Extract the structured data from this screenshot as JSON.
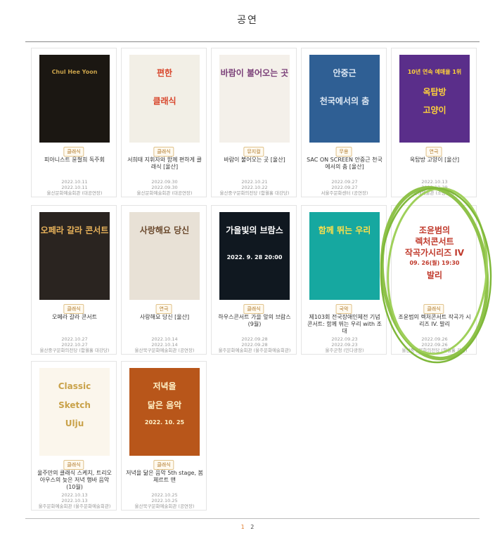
{
  "page": {
    "title": "공연"
  },
  "cards": [
    {
      "category": "클래식",
      "name": "피아니스트 윤철희 독주회",
      "d1": "2022.10.11",
      "d2": "2022.10.11",
      "venue": "울산문화예술회관 (대공연장)",
      "poster": {
        "bg": "#1b1712",
        "accent": "#c9a24a",
        "lines": [
          "Chul Hee Yoon"
        ]
      }
    },
    {
      "category": "클래식",
      "name": "서희태 지휘자와 함께 편하게 클래식 [울산]",
      "d1": "2022.09.30",
      "d2": "2022.09.30",
      "venue": "울산문화예술회관 (대공연장)",
      "poster": {
        "bg": "#f2efe6",
        "accent": "#d8452b",
        "lines": [
          "편한",
          "클래식"
        ]
      }
    },
    {
      "category": "뮤지컬",
      "name": "바람이 불어오는 곳 [울산]",
      "d1": "2022.10.21",
      "d2": "2022.10.22",
      "venue": "울산중구문화의전당 (함월홀 대강당)",
      "poster": {
        "bg": "#f4f0ea",
        "accent": "#7a3f78",
        "lines": [
          "바람이 불어오는 곳"
        ]
      }
    },
    {
      "category": "무용",
      "name": "SAC ON SCREEN 안중근 천국에서의 춤 [울산]",
      "d1": "2022.09.27",
      "d2": "2022.09.27",
      "venue": "서울주문화센터 (공연장)",
      "poster": {
        "bg": "#2f5f94",
        "accent": "#dfe9f4",
        "lines": [
          "안중근",
          "천국에서의 춤"
        ]
      }
    },
    {
      "category": "연극",
      "name": "옥탑방 고양이 [울산]",
      "d1": "2022.10.13",
      "d2": "2022.10.29",
      "venue": "현대예술관 (소공연장)",
      "poster": {
        "bg": "#5a2e8a",
        "accent": "#ffd23a",
        "lines": [
          "10년 연속 예매율 1위",
          "옥탑방",
          "고양이"
        ]
      }
    },
    {
      "category": "클래식",
      "name": "오페라 갈라 콘서트",
      "d1": "2022.10.27",
      "d2": "2022.10.27",
      "venue": "울산중구문화의전당 (함월홀 대강당)",
      "poster": {
        "bg": "#2a2420",
        "accent": "#e6b15a",
        "lines": [
          "오페라 갈라 콘서트"
        ]
      }
    },
    {
      "category": "연극",
      "name": "사랑해요 당신 [울산]",
      "d1": "2022.10.14",
      "d2": "2022.10.14",
      "venue": "울산북구문화예술회관 (공연장)",
      "poster": {
        "bg": "#e8e1d6",
        "accent": "#6b4a2e",
        "lines": [
          "사랑해요 당신"
        ]
      }
    },
    {
      "category": "클래식",
      "name": "하우스콘서트 가을 앞의 브람스 (9월)",
      "d1": "2022.09.28",
      "d2": "2022.09.28",
      "venue": "울주문화예술회관 (울주문화예술회관)",
      "poster": {
        "bg": "#101820",
        "accent": "#ffffff",
        "lines": [
          "가을빛의 브람스",
          "2022. 9. 28 20:00"
        ]
      }
    },
    {
      "category": "국악",
      "name": "제103회 전국장애인체전 기념 콘서트: 함께 뛰는 우리 with 조대",
      "d1": "2022.09.23",
      "d2": "2022.09.23",
      "venue": "울주군청 (민다광장)",
      "poster": {
        "bg": "#16a8a0",
        "accent": "#ffe04a",
        "lines": [
          "함께 뛰는 우리"
        ]
      }
    },
    {
      "category": "클래식",
      "name": "조윤범의 렉처콘서트 작곡가 시리즈 IV. 발리",
      "d1": "2022.09.26",
      "d2": "2022.09.26",
      "venue": "울산중구문화의전당 (함월홀 강당)",
      "poster": {
        "bg": "#ffffff",
        "accent": "#c0392b",
        "lines": [
          "조윤범의",
          "렉처콘서트",
          "작곡가시리즈 IV",
          "09. 26(월) 19:30",
          "발리"
        ]
      }
    },
    {
      "category": "클래식",
      "name": "울주만의 클래식 스케치, 트리오아우스의 늦은 저녁 행바 음악 (10월)",
      "d1": "2022.10.13",
      "d2": "2022.10.13",
      "venue": "울주문화예술회관 (울주문화예술회관)",
      "poster": {
        "bg": "#fbf6ec",
        "accent": "#c9a24a",
        "lines": [
          "Classic",
          "Sketch",
          "Ulju"
        ]
      }
    },
    {
      "category": "클래식",
      "name": "저녁을 닮은 음악 5th stage, 봄체르트 맨",
      "d1": "2022.10.25",
      "d2": "2022.10.25",
      "venue": "울산북구문화예술회관 (공연장)",
      "poster": {
        "bg": "#b8561a",
        "accent": "#fff2c8",
        "lines": [
          "저녁을",
          "닮은 음악",
          "2022. 10. 25"
        ]
      }
    }
  ],
  "pagination": {
    "current": "1",
    "other": "2"
  },
  "colors": {
    "accent": "#e07a2a",
    "highlight_circle": "#8fc24a"
  }
}
